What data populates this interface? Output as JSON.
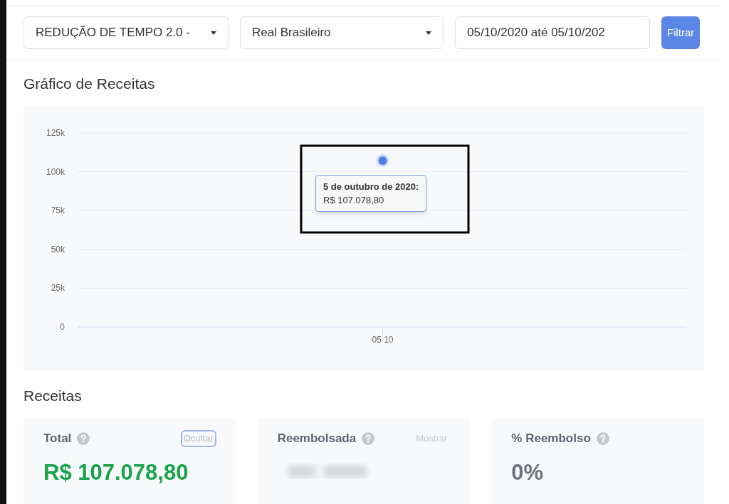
{
  "filters": {
    "campaign": "REDUÇÃO DE TEMPO 2.0 -",
    "currency": "Real Brasileiro",
    "date_range": "05/10/2020 até 05/10/202",
    "button": "Filtrar"
  },
  "chart_section": {
    "title": "Gráfico de Receitas",
    "chart_data": {
      "type": "line",
      "categories": [
        "05 10"
      ],
      "grid": true,
      "series": [
        {
          "color": "#4f7fe6",
          "marker": true,
          "values": [
            107100
          ]
        }
      ],
      "ylim": [
        0,
        125000
      ],
      "yticks": [
        {
          "value": 0,
          "label": "0"
        },
        {
          "value": 25000,
          "label": "25k"
        },
        {
          "value": 50000,
          "label": "50k"
        },
        {
          "value": 75000,
          "label": "75k"
        },
        {
          "value": 100000,
          "label": "100k"
        },
        {
          "value": 125000,
          "label": "125k"
        }
      ]
    },
    "tooltip": {
      "title": "5 de outubro de 2020:",
      "value": "R$ 107.078,80"
    }
  },
  "revenue_section": {
    "title": "Receitas",
    "cards": [
      {
        "label": "Total",
        "toggle": "Ocultar",
        "hidden": false,
        "value": "R$ 107.078,80",
        "color": "#16a34a"
      },
      {
        "label": "Reembolsada",
        "toggle": "Mostrar",
        "hidden": true
      },
      {
        "label": "% Reembolso",
        "value": "0%",
        "color": "#6b7280"
      }
    ]
  }
}
